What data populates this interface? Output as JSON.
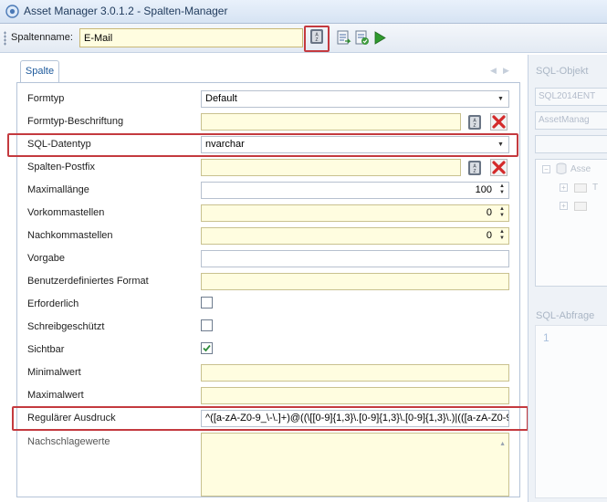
{
  "window": {
    "title": "Asset Manager 3.0.1.2 - Spalten-Manager"
  },
  "toolbar": {
    "column_name_label": "Spaltenname:",
    "column_name_value": "E-Mail"
  },
  "tabs": [
    {
      "label": "Spalte"
    }
  ],
  "properties": [
    {
      "label": "Formtyp",
      "value": "Default",
      "control": "dropdown"
    },
    {
      "label": "Formtyp-Beschriftung",
      "value": "",
      "control": "text-with-buttons"
    },
    {
      "label": "SQL-Datentyp",
      "value": "nvarchar",
      "control": "dropdown"
    },
    {
      "label": "Spalten-Postfix",
      "value": "",
      "control": "text-with-buttons"
    },
    {
      "label": "Maximallänge",
      "value": "100",
      "control": "spinner"
    },
    {
      "label": "Vorkommastellen",
      "value": "0",
      "control": "spinner"
    },
    {
      "label": "Nachkommastellen",
      "value": "0",
      "control": "spinner"
    },
    {
      "label": "Vorgabe",
      "value": "",
      "control": "text"
    },
    {
      "label": "Benutzerdefiniertes Format",
      "value": "",
      "control": "text"
    },
    {
      "label": "Erforderlich",
      "checked": false,
      "control": "checkbox"
    },
    {
      "label": "Schreibgeschützt",
      "checked": false,
      "control": "checkbox"
    },
    {
      "label": "Sichtbar",
      "checked": true,
      "control": "checkbox"
    },
    {
      "label": "Minimalwert",
      "value": "",
      "control": "text"
    },
    {
      "label": "Maximalwert",
      "value": "",
      "control": "text"
    },
    {
      "label": "Regulärer Ausdruck",
      "value": "^([a-zA-Z0-9_\\-\\.]+)@((\\[[0-9]{1,3}\\.[0-9]{1,3}\\.[0-9]{1,3}\\.)|(([a-zA-Z0-9",
      "control": "text"
    },
    {
      "label": "Nachschlagewerte",
      "value": "",
      "control": "textarea"
    }
  ],
  "right_pane": {
    "objects_header": "SQL-Objekt",
    "server_box": "SQL2014ENT",
    "database_box": "AssetManag",
    "tree_root": "Asse",
    "tree_child_1": "T",
    "query_header": "SQL-Abfrage",
    "line_number": "1"
  },
  "colors": {
    "highlight_red": "#c43a3f",
    "field_yellow": "#fffde0",
    "tab_blue": "#1e5a9c"
  },
  "icons": [
    "app-icon",
    "sort-az-icon",
    "script-icon",
    "save-check-icon",
    "run-icon",
    "sort-az-icon",
    "delete-icon",
    "checkmark-icon"
  ]
}
